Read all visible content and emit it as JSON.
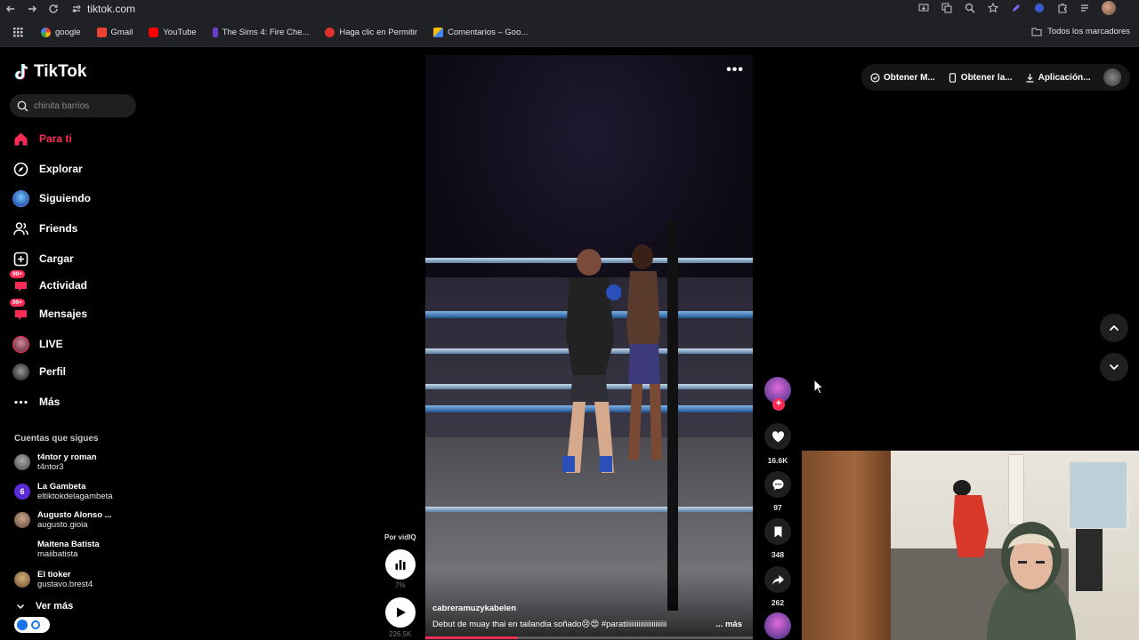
{
  "browser": {
    "url": "tiktok.com",
    "bookmarks": [
      {
        "label": "google",
        "color": "#4285f4"
      },
      {
        "label": "Gmail",
        "color": "#ea4335"
      },
      {
        "label": "YouTube",
        "color": "#ff0000"
      },
      {
        "label": "The Sims 4: Fire Che...",
        "color": "#6a3ed1"
      },
      {
        "label": "Haga clic en Permitir",
        "color": "#e03131"
      },
      {
        "label": "Comentarios – Goo...",
        "color": "#fbbc04"
      }
    ],
    "all_bookmarks": "Todos los marcadores"
  },
  "tiktok": {
    "logo": "TikTok",
    "search_placeholder": "chinita barrios",
    "menu": [
      {
        "label": "Para ti",
        "icon": "home-icon",
        "active": true
      },
      {
        "label": "Explorar",
        "icon": "compass-icon"
      },
      {
        "label": "Siguiendo",
        "icon": "following-avatar"
      },
      {
        "label": "Friends",
        "icon": "friends-icon"
      },
      {
        "label": "Cargar",
        "icon": "upload-icon"
      },
      {
        "label": "Actividad",
        "icon": "activity-icon",
        "badge": "99+"
      },
      {
        "label": "Mensajes",
        "icon": "messages-icon",
        "badge": "99+"
      },
      {
        "label": "LIVE",
        "icon": "live-avatar"
      },
      {
        "label": "Perfil",
        "icon": "profile-avatar"
      },
      {
        "label": "Más",
        "icon": "more-dots-icon"
      }
    ],
    "follows_title": "Cuentas que sigues",
    "follows": [
      {
        "name": "t4ntor y roman",
        "user": "t4ntor3",
        "color": "#777"
      },
      {
        "name": "La Gambeta",
        "user": "eltiktokdelagambeta",
        "color": "#5a2bd6"
      },
      {
        "name": "Augusto Alonso ...",
        "user": "augusto.gioia",
        "color": "#8a6a55"
      },
      {
        "name": "Maitena Batista",
        "user": "maiibatista",
        "color": ""
      },
      {
        "name": "El tioker",
        "user": "gustavo.brest4",
        "color": "#a07a4a"
      }
    ],
    "see_more": "Ver más",
    "top_right": [
      {
        "label": "Obtener M...",
        "icon": "coin-icon"
      },
      {
        "label": "Obtener la...",
        "icon": "phone-icon"
      },
      {
        "label": "Aplicación...",
        "icon": "download-icon"
      }
    ],
    "video": {
      "author": "cabreramuzykabelen",
      "description": "Debut de muay thai en tailandia soñado😢😍 #paratiiiiiiiiiiiiiiiiiiiiii",
      "more": "... más",
      "progress": 0.28
    },
    "actions": {
      "likes": "16.6K",
      "comments": "97",
      "saves": "348",
      "shares": "262"
    },
    "vidiq": {
      "label": "Por vidIQ",
      "percent": "7%",
      "views": "226.5K"
    }
  },
  "colors": {
    "accent": "#fe2c55",
    "background": "#000000"
  }
}
